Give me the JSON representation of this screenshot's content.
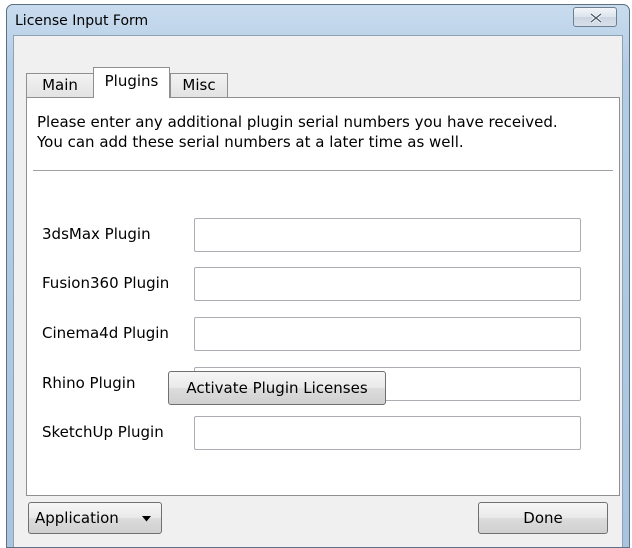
{
  "window": {
    "title": "License Input Form"
  },
  "tabs": [
    {
      "label": "Main"
    },
    {
      "label": "Plugins"
    },
    {
      "label": "Misc"
    }
  ],
  "active_tab": "Plugins",
  "plugins_panel": {
    "intro_line1": "Please enter any additional plugin serial numbers you have received.",
    "intro_line2": "You can add these serial numbers at a later time as well.",
    "rows": [
      {
        "label": "3dsMax Plugin",
        "value": ""
      },
      {
        "label": "Fusion360 Plugin",
        "value": ""
      },
      {
        "label": "Cinema4d Plugin",
        "value": ""
      },
      {
        "label": "Rhino Plugin",
        "value": ""
      },
      {
        "label": "SketchUp Plugin",
        "value": ""
      }
    ],
    "activate_label": "Activate Plugin Licenses"
  },
  "footer": {
    "application_label": "Application",
    "done_label": "Done"
  },
  "icons": {
    "close": "close-icon",
    "dropdown": "chevron-down-icon"
  }
}
